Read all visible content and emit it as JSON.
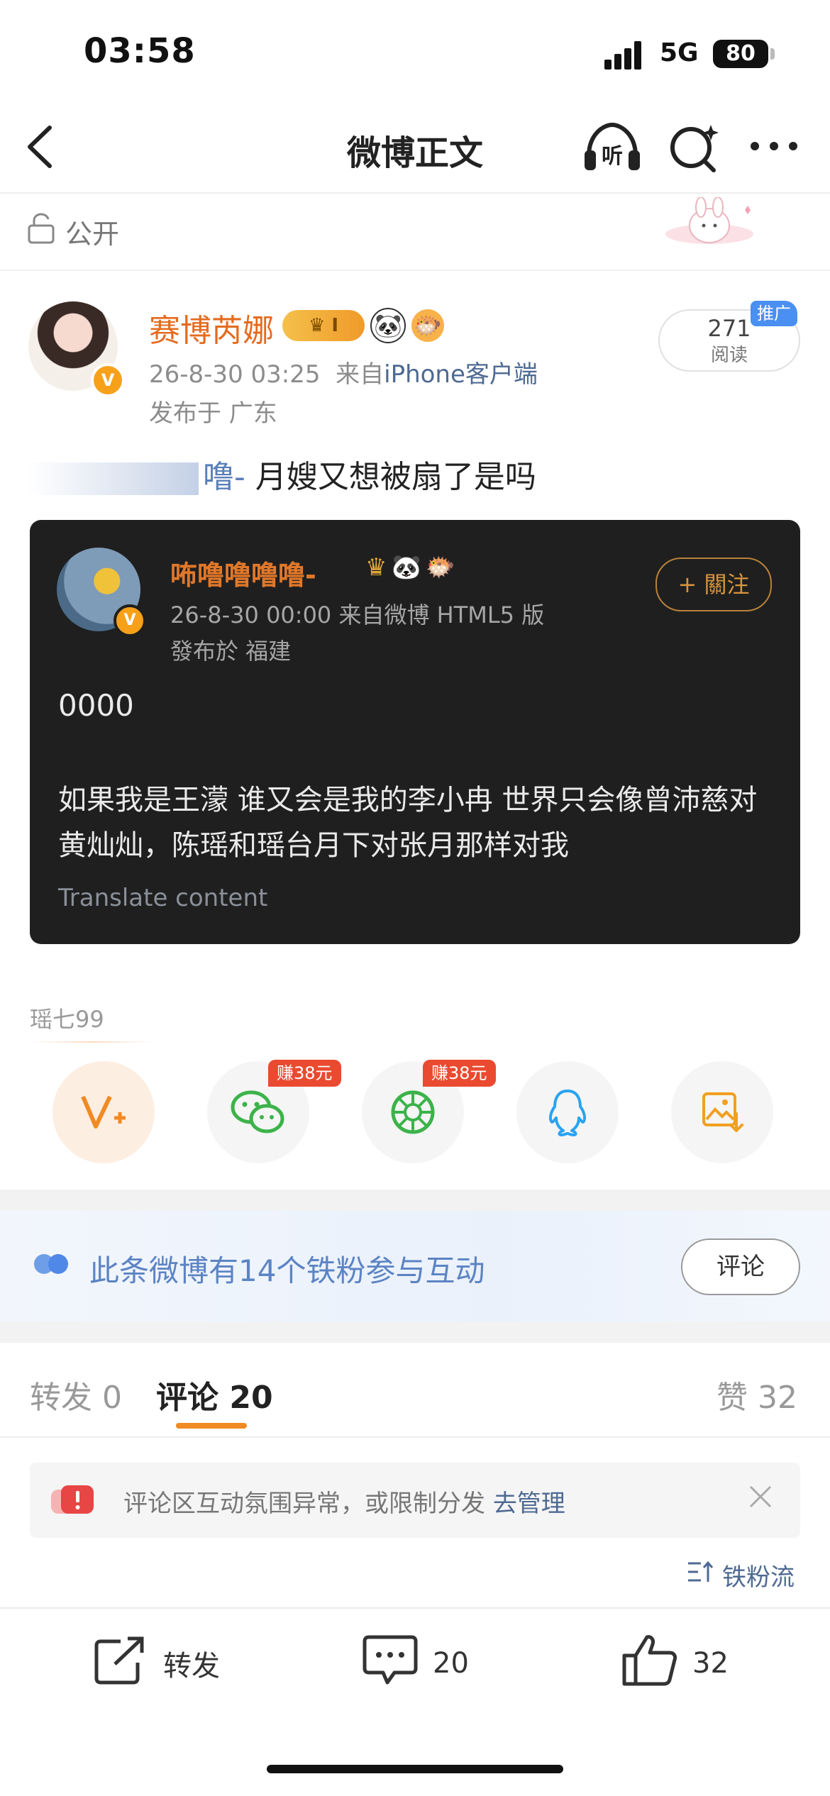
{
  "status_bar": {
    "time": "03:58",
    "network": "5G",
    "battery": "80"
  },
  "nav": {
    "title": "微博正文"
  },
  "visibility": {
    "label": "公开"
  },
  "post": {
    "author": {
      "name": "赛博芮娜",
      "level_badge": "I",
      "verified_mark": "V"
    },
    "meta": {
      "time": "26-8-30 03:25",
      "from_prefix": "来自",
      "source": "iPhone客户端",
      "location": "发布于 广东"
    },
    "read": {
      "count": "271",
      "label": "阅读",
      "promo_tag": "推广"
    },
    "text": {
      "mention_fragment": "噜-",
      "body": " 月嫂又想被扇了是吗"
    }
  },
  "quoted_post": {
    "author": {
      "name": "咘噜噜噜噜-",
      "verified_mark": "V"
    },
    "meta": "26-8-30 00:00  来自微博 HTML5 版",
    "location": "發布於 福建",
    "follow_button": "+ 關注",
    "text_line1": "0000",
    "text_body": "如果我是王濛 谁又会是我的李小冉 世界只会像曾沛慈对黄灿灿，陈瑶和瑶台月下对张月那样对我",
    "translate_label": "Translate content"
  },
  "share": {
    "recent_user": "瑶七99",
    "targets": [
      {
        "icon": "weibo-repost-icon",
        "earn": ""
      },
      {
        "icon": "wechat-icon",
        "earn": "赚38元"
      },
      {
        "icon": "moments-icon",
        "earn": "赚38元"
      },
      {
        "icon": "qq-icon",
        "earn": ""
      },
      {
        "icon": "save-image-icon",
        "earn": ""
      }
    ]
  },
  "fans_banner": {
    "text": "此条微博有14个铁粉参与互动",
    "button": "评论"
  },
  "tabs": [
    {
      "label": "转发",
      "count": "0"
    },
    {
      "label": "评论",
      "count": "20"
    },
    {
      "label": "赞",
      "count": "32"
    }
  ],
  "notice": {
    "text": "评论区互动氛围异常，或限制分发",
    "link": "去管理"
  },
  "sort": {
    "label": "铁粉流"
  },
  "bottom_bar": {
    "repost_label": "转发",
    "comment_count": "20",
    "like_count": "32"
  },
  "colors": {
    "accent": "#f08a22",
    "link": "#4e6a92",
    "name_orange": "#e46b1f",
    "card_bg": "#1f1f1f"
  }
}
